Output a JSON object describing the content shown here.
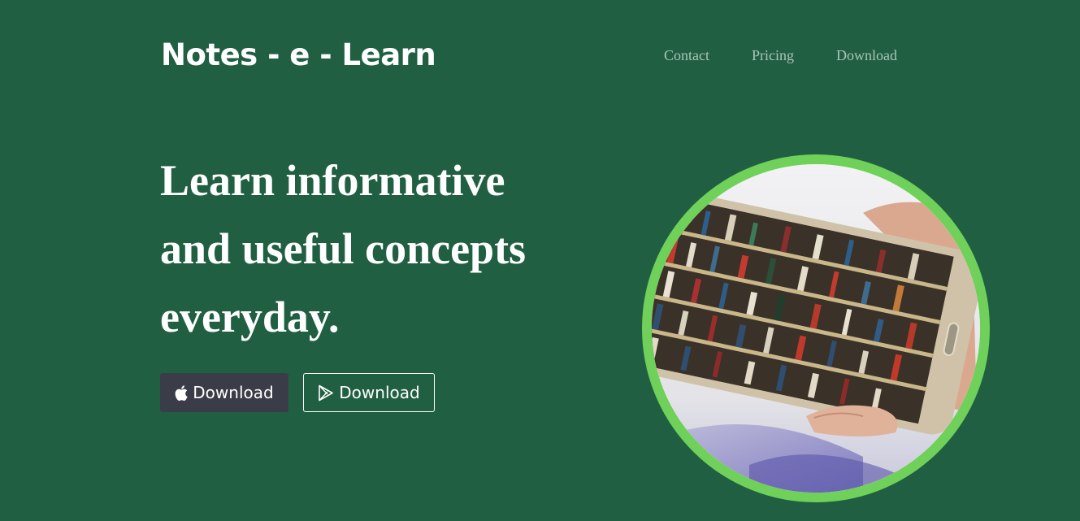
{
  "header": {
    "brand": "Notes - e - Learn",
    "nav": [
      {
        "label": "Contact"
      },
      {
        "label": "Pricing"
      },
      {
        "label": "Download"
      }
    ]
  },
  "hero": {
    "headline": "Learn informative and useful concepts everyday.",
    "apple_button_label": "Download",
    "play_button_label": "Download",
    "image_alt": "Hand holding phone showing library bookshelf"
  },
  "colors": {
    "background": "#215f43",
    "circle_border": "#6fd05a",
    "apple_button": "#3a3d47",
    "nav_text": "#a9c5b7"
  },
  "icons": {
    "apple_button": "apple-icon",
    "play_button": "google-play-icon"
  }
}
